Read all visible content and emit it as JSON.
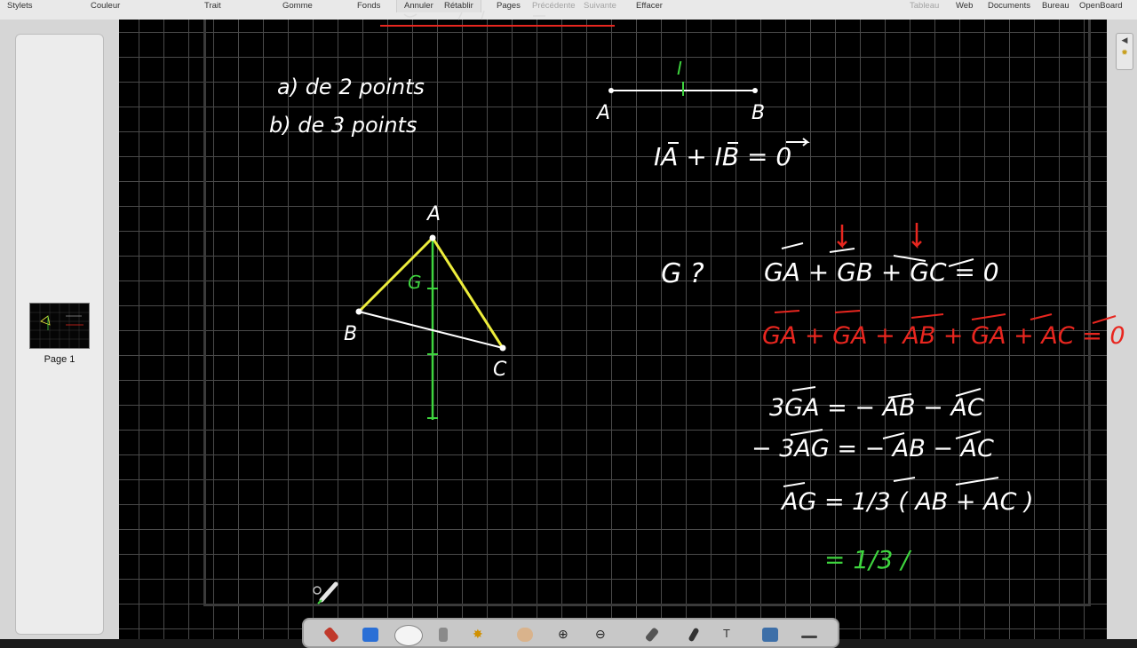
{
  "toolbar": {
    "stylets": "Stylets",
    "couleur": "Couleur",
    "trait": "Trait",
    "gomme": "Gomme",
    "fonds": "Fonds",
    "annuler": "Annuler",
    "retablir": "Rétablir",
    "pages": "Pages",
    "precedente": "Précédente",
    "suivante": "Suivante",
    "effacer": "Effacer",
    "tableau": "Tableau",
    "web": "Web",
    "documents": "Documents",
    "bureau": "Bureau",
    "openboard": "OpenBoard"
  },
  "sidebar": {
    "page_label": "Page 1"
  },
  "board": {
    "list_a": "a) de 2 points",
    "list_b": "b) de 3 points",
    "label_I": "I",
    "label_A_seg": "A",
    "label_B_seg": "B",
    "eq_midpoint": "IA + IB = 0",
    "tri_A": "A",
    "tri_B": "B",
    "tri_C": "C",
    "tri_G": "G",
    "g_question": "G ?",
    "eq1": "GA + GB + GC = 0",
    "eq2": "GA + GA + AB + GA + AC = 0",
    "eq3": "3GA = − AB − AC",
    "eq4": "− 3AG = − AB − AC",
    "eq5": "AG = 1/3 ( AB + AC )",
    "eq6": "= 1/3 /"
  },
  "colors": {
    "board_bg": "#000000",
    "grid": "#4a4a4a",
    "chalk_white": "#ffffff",
    "chalk_green": "#3ed43e",
    "chalk_red": "#e8261f",
    "chalk_yellow": "#eded3c"
  }
}
